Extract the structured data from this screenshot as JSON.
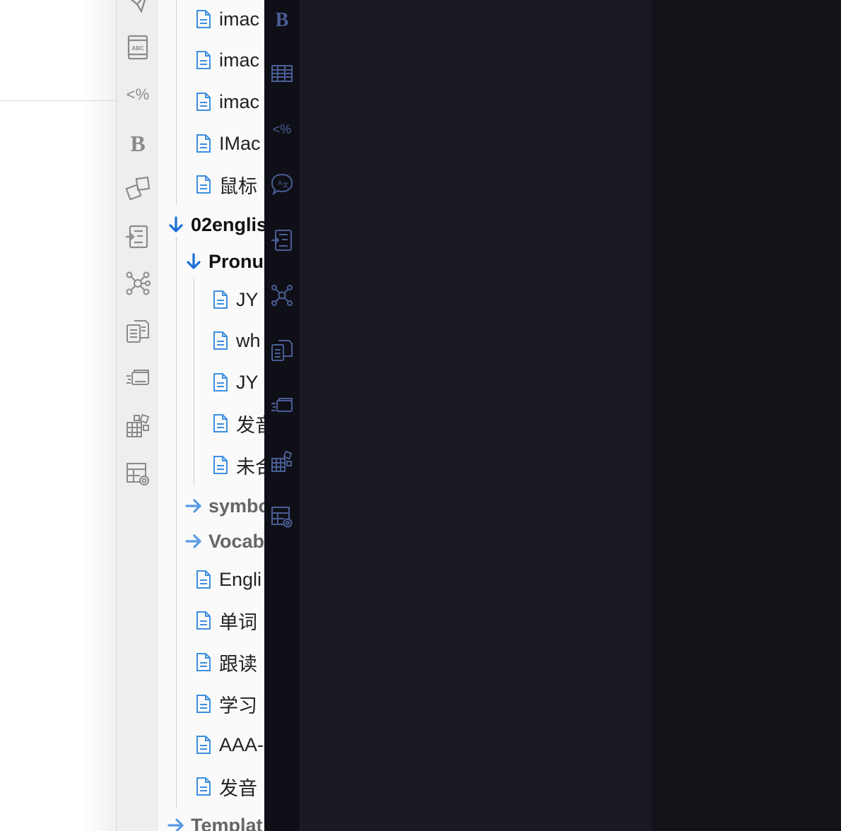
{
  "colors": {
    "folder_arrow_open": "#1a6fd8",
    "folder_arrow_closed": "#5a9be6",
    "doc_icon": "#3d8fe0",
    "rail_light_icon": "#8a8a8a",
    "rail_dark_icon": "#4a5e96",
    "editor_bg": "#1a1a24"
  },
  "rail_light": {
    "icons": [
      "send-icon",
      "spellcheck-icon",
      "template-tag-icon",
      "bold-icon",
      "shapes-icon",
      "import-icon",
      "graph-icon",
      "documents-icon",
      "cards-icon",
      "grid-shapes-icon",
      "table-settings-icon"
    ]
  },
  "rail_dark": {
    "icons": [
      "bold-icon",
      "table-icon",
      "template-tag-icon",
      "translate-icon",
      "import-icon",
      "graph-icon",
      "documents-icon",
      "cards-icon",
      "grid-shapes-icon",
      "table-settings-icon"
    ]
  },
  "tree": {
    "items": [
      {
        "type": "doc",
        "label": "imac"
      },
      {
        "type": "doc",
        "label": "imac"
      },
      {
        "type": "doc",
        "label": "imac"
      },
      {
        "type": "doc",
        "label": "IMac"
      },
      {
        "type": "doc",
        "label": "鼠标"
      },
      {
        "type": "folder",
        "label": "02englis"
      },
      {
        "type": "folder",
        "label": "Pronu"
      },
      {
        "type": "doc",
        "label": "JY"
      },
      {
        "type": "doc",
        "label": "wh"
      },
      {
        "type": "doc",
        "label": "JY"
      },
      {
        "type": "doc",
        "label": "发音"
      },
      {
        "type": "doc",
        "label": "未合"
      },
      {
        "type": "folder",
        "label": "symbo"
      },
      {
        "type": "folder",
        "label": "Vocab"
      },
      {
        "type": "doc",
        "label": "Engli"
      },
      {
        "type": "doc",
        "label": "单词"
      },
      {
        "type": "doc",
        "label": "跟读"
      },
      {
        "type": "doc",
        "label": "学习"
      },
      {
        "type": "doc",
        "label": "AAA-"
      },
      {
        "type": "doc",
        "label": "发音"
      },
      {
        "type": "folder",
        "label": "Templat"
      }
    ]
  }
}
